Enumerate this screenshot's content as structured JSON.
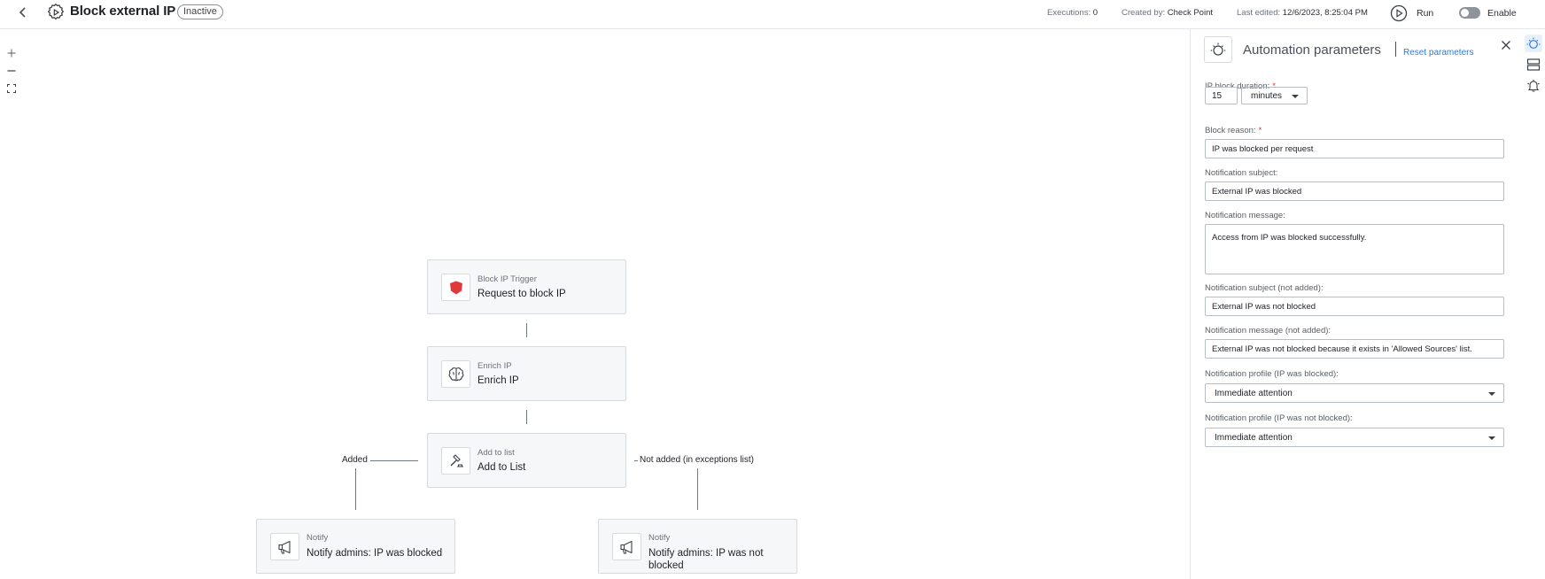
{
  "header": {
    "title": "Block external IP",
    "status": "Inactive",
    "executions_label": "Executions:",
    "executions_value": "0",
    "created_by_label": "Created by:",
    "created_by_value": "Check Point",
    "last_edited_label": "Last edited:",
    "last_edited_value": "12/6/2023, 8:25:04 PM",
    "run_label": "Run",
    "enable_label": "Enable",
    "enabled": false
  },
  "canvas": {
    "zoom_in": "+",
    "zoom_out": "−",
    "nodes": {
      "trigger": {
        "type": "Block IP Trigger",
        "name": "Request to block IP",
        "icon": "shield-icon"
      },
      "enrich": {
        "type": "Enrich IP",
        "name": "Enrich IP",
        "icon": "brain-icon"
      },
      "add_to_list": {
        "type": "Add to list",
        "name": "Add to List",
        "icon": "gavel-icon"
      },
      "notify_blocked": {
        "type": "Notify",
        "name": "Notify admins: IP was blocked",
        "icon": "megaphone-icon"
      },
      "notify_not_blocked": {
        "type": "Notify",
        "name": "Notify admins: IP was not blocked",
        "icon": "megaphone-icon"
      }
    },
    "edges": {
      "added": "Added",
      "not_added": "Not added (in exceptions list)"
    }
  },
  "panel": {
    "title": "Automation parameters",
    "reset_label": "Reset parameters",
    "fields": {
      "ip_block_duration": {
        "label": "IP block duration:",
        "value": "15",
        "unit": "minutes"
      },
      "block_reason": {
        "label": "Block reason:",
        "value": "IP was blocked per request"
      },
      "notification_subject": {
        "label": "Notification subject:",
        "value": "External IP was blocked"
      },
      "notification_message": {
        "label": "Notification message:",
        "value": "Access from IP was blocked successfully."
      },
      "notification_subject_not_added": {
        "label": "Notification subject (not added):",
        "value": "External IP was not blocked"
      },
      "notification_message_not_added": {
        "label": "Notification message (not added):",
        "value": "External IP was not blocked because it exists in 'Allowed Sources' list."
      },
      "notification_profile_blocked": {
        "label": "Notification profile (IP was blocked):",
        "value": "Immediate attention"
      },
      "notification_profile_not_blocked": {
        "label": "Notification profile (IP was not blocked):",
        "value": "Immediate attention"
      }
    }
  },
  "rail": {
    "items": [
      "automation-params-icon",
      "layout-icon",
      "notification-bell-icon"
    ]
  },
  "colors": {
    "accent": "#2f7bd9",
    "trigger_red": "#e0383b",
    "required": "#d93636"
  }
}
